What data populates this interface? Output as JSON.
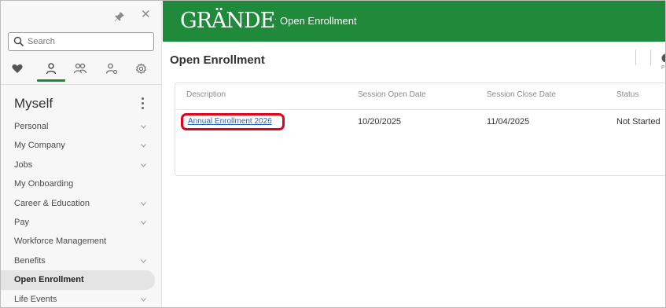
{
  "header": {
    "logo_text": "GRÄNDE",
    "logo_mark": ".",
    "app_title": "Open Enrollment",
    "brand_color": "#1f8b3a"
  },
  "sidebar": {
    "search_placeholder": "Search",
    "icons": [
      "heart-icon",
      "person-icon",
      "people-icon",
      "person-settings-icon",
      "settings-icon"
    ],
    "section_title": "Myself",
    "items": [
      {
        "label": "Personal",
        "has_chevron": true
      },
      {
        "label": "My Company",
        "has_chevron": true
      },
      {
        "label": "Jobs",
        "has_chevron": true
      },
      {
        "label": "My Onboarding",
        "has_chevron": false
      },
      {
        "label": "Career & Education",
        "has_chevron": true
      },
      {
        "label": "Pay",
        "has_chevron": true
      },
      {
        "label": "Workforce Management",
        "has_chevron": false
      },
      {
        "label": "Benefits",
        "has_chevron": true
      },
      {
        "label": "Open Enrollment",
        "has_chevron": false,
        "selected": true
      },
      {
        "label": "Life Events",
        "has_chevron": true
      }
    ]
  },
  "main": {
    "page_title": "Open Enrollment",
    "partial_label": "P",
    "table": {
      "columns": [
        "Description",
        "Session Open Date",
        "Session Close Date",
        "Status"
      ],
      "rows": [
        {
          "description": "Annual Enrollment 2026",
          "open_date": "10/20/2025",
          "close_date": "11/04/2025",
          "status": "Not Started"
        }
      ]
    },
    "highlight_color": "#e3001b"
  }
}
